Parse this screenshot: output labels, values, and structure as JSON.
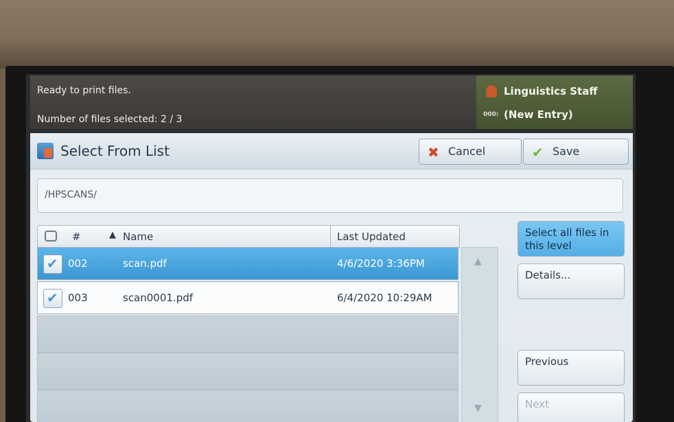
{
  "status": {
    "line1": "Ready to print files.",
    "line2": "Number of files selected: 2 / 3"
  },
  "user": {
    "name": "Linguistics Staff",
    "entry": "(New Entry)",
    "code": "000:"
  },
  "header": {
    "title": "Select From List",
    "cancel_label": "Cancel",
    "save_label": "Save"
  },
  "path": "/HPSCANS/",
  "table": {
    "columns": [
      "#",
      "Name",
      "Last Updated"
    ],
    "rows": [
      {
        "num": "002",
        "name": "scan.pdf",
        "date": "4/6/2020 3:36PM",
        "selected": true,
        "checked": true
      },
      {
        "num": "003",
        "name": "scan0001.pdf",
        "date": "6/4/2020 10:29AM",
        "selected": false,
        "checked": true
      }
    ]
  },
  "side_buttons": {
    "select_all": "Select all files in this level",
    "details": "Details...",
    "previous": "Previous",
    "next": "Next"
  },
  "icons": {
    "cancel": "x-icon",
    "save": "check-icon",
    "sort": "sort-ascending-icon",
    "printer": "printer-icon"
  },
  "colors": {
    "selected_row": "#3b97d3",
    "active_button": "#54aee6"
  }
}
